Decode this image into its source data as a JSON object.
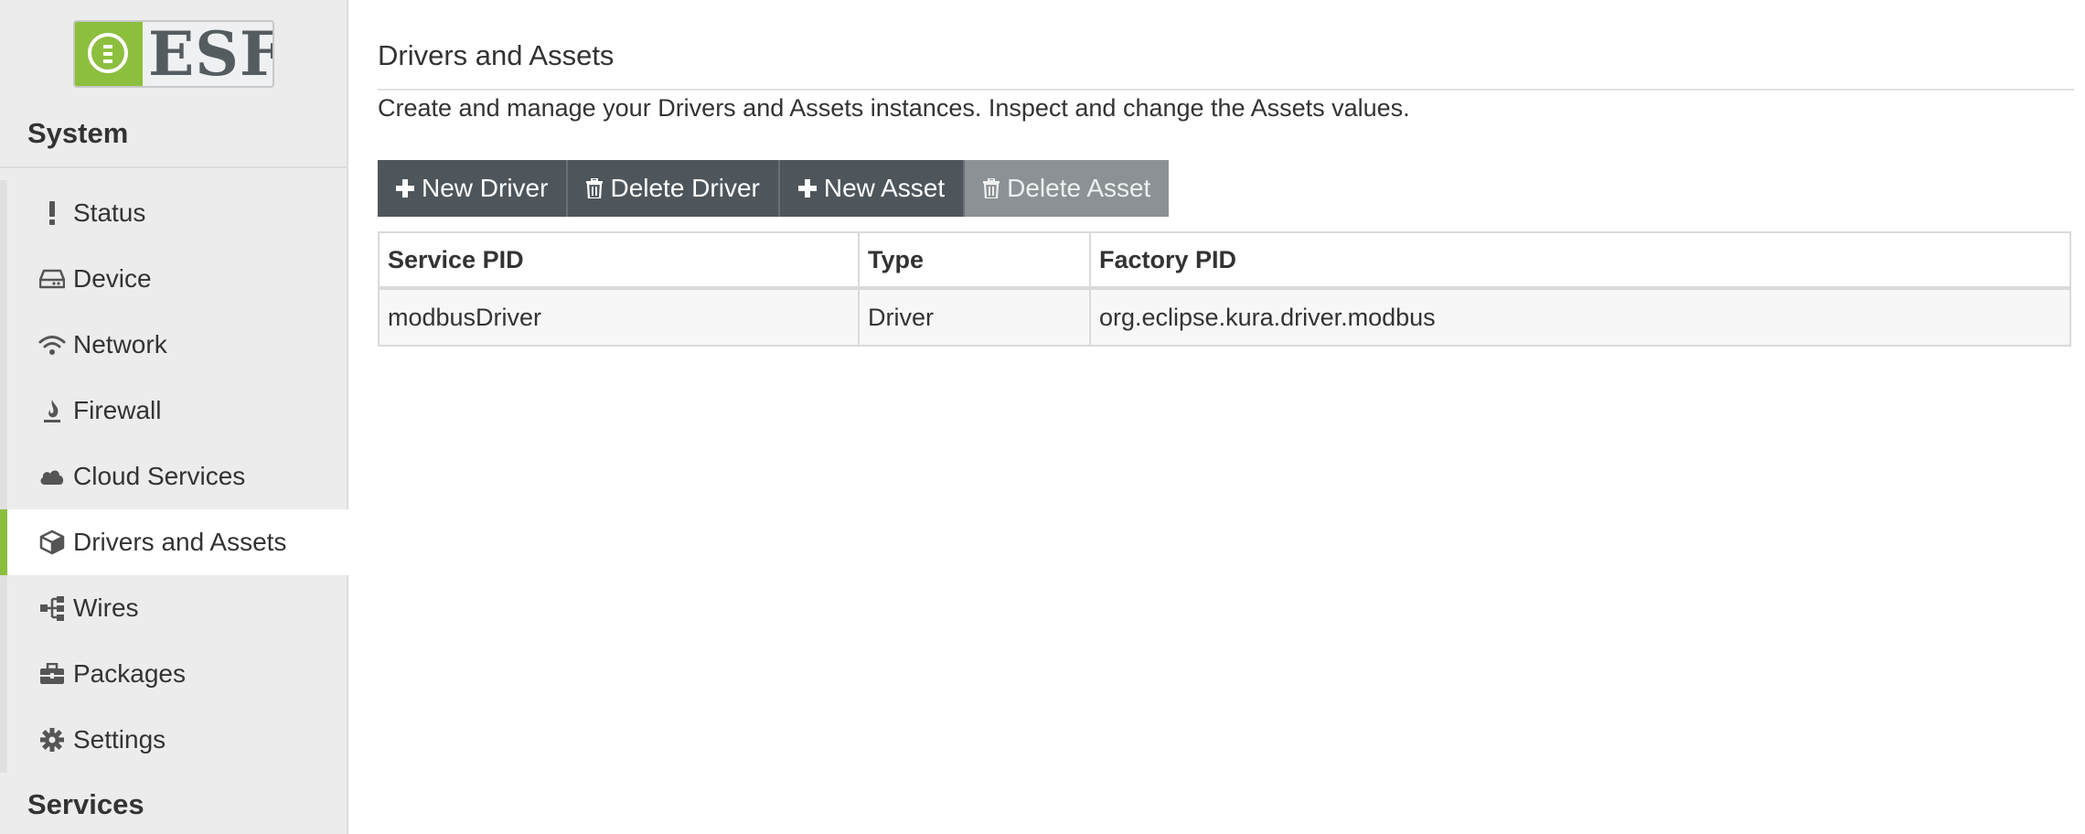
{
  "logo": {
    "text": "ESF",
    "accent": "#8dbf3f"
  },
  "sidebar": {
    "system_title": "System",
    "services_title": "Services",
    "items": [
      {
        "label": "Status",
        "icon": "exclamation-icon",
        "active": false
      },
      {
        "label": "Device",
        "icon": "hard-drive-icon",
        "active": false
      },
      {
        "label": "Network",
        "icon": "wifi-icon",
        "active": false
      },
      {
        "label": "Firewall",
        "icon": "fire-icon",
        "active": false
      },
      {
        "label": "Cloud Services",
        "icon": "cloud-icon",
        "active": false
      },
      {
        "label": "Drivers and Assets",
        "icon": "cube-icon",
        "active": true
      },
      {
        "label": "Wires",
        "icon": "sitemap-icon",
        "active": false
      },
      {
        "label": "Packages",
        "icon": "briefcase-icon",
        "active": false
      },
      {
        "label": "Settings",
        "icon": "gear-icon",
        "active": false
      }
    ]
  },
  "main": {
    "title": "Drivers and Assets",
    "description": "Create and manage your Drivers and Assets instances. Inspect and change the Assets values.",
    "toolbar": {
      "new_driver": "New Driver",
      "delete_driver": "Delete Driver",
      "new_asset": "New Asset",
      "delete_asset": "Delete Asset"
    },
    "table": {
      "columns": [
        "Service PID",
        "Type",
        "Factory PID"
      ],
      "rows": [
        [
          "modbusDriver",
          "Driver",
          "org.eclipse.kura.driver.modbus"
        ]
      ]
    }
  }
}
